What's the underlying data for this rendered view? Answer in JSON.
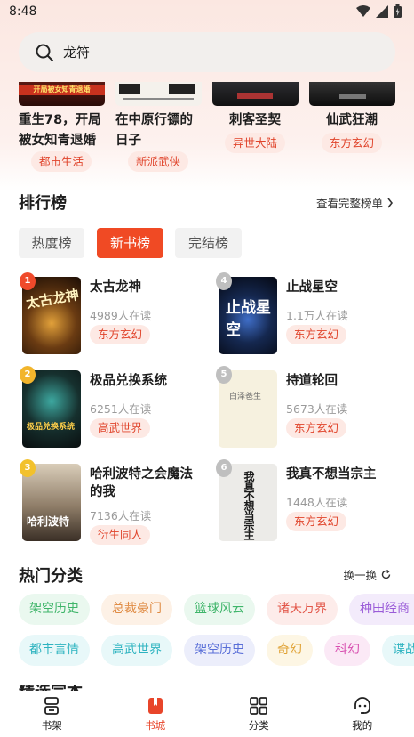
{
  "status": {
    "time": "8:48"
  },
  "search": {
    "query": "龙符"
  },
  "top_books": [
    {
      "title_line1": "重生78，开局",
      "title_line2": "被女知青退婚",
      "tag": "都市生活",
      "cover_text": "开局被女知青退婚"
    },
    {
      "title_line1": "在中原行镖的",
      "title_line2": "日子",
      "tag": "新派武侠",
      "cover_text": ""
    },
    {
      "title_line1": "刺客圣契",
      "title_line2": "",
      "tag": "异世大陆",
      "cover_text": ""
    },
    {
      "title_line1": "仙武狂潮",
      "title_line2": "",
      "tag": "东方玄幻",
      "cover_text": ""
    }
  ],
  "ranking": {
    "title": "排行榜",
    "see_all": "查看完整榜单",
    "tabs": [
      {
        "label": "热度榜",
        "active": false
      },
      {
        "label": "新书榜",
        "active": true
      },
      {
        "label": "完结榜",
        "active": false
      }
    ],
    "items": [
      {
        "rank": "1",
        "name": "太古龙神",
        "readers": "4989人在读",
        "tag": "东方玄幻",
        "cover_text": "太古龙神"
      },
      {
        "rank": "4",
        "name": "止战星空",
        "readers": "1.1万人在读",
        "tag": "东方玄幻",
        "cover_text": "止战星空"
      },
      {
        "rank": "2",
        "name": "极品兑换系统",
        "readers": "6251人在读",
        "tag": "高武世界",
        "cover_text": "极品兑换系统"
      },
      {
        "rank": "5",
        "name": "持道轮回",
        "readers": "5673人在读",
        "tag": "东方玄幻",
        "cover_text": "白泽爸生"
      },
      {
        "rank": "3",
        "name_line1": "哈利波特之会魔法",
        "name_line2": "的我",
        "readers": "7136人在读",
        "tag": "衍生同人",
        "cover_text": "哈利波特"
      },
      {
        "rank": "6",
        "name": "我真不想当宗主",
        "readers": "1448人在读",
        "tag": "东方玄幻",
        "cover_text": "我真不想当宗主"
      }
    ]
  },
  "categories": {
    "title": "热门分类",
    "refresh": "换一换",
    "row1": [
      "架空历史",
      "总裁豪门",
      "篮球风云",
      "诸天万界",
      "种田经商"
    ],
    "row2": [
      "都市言情",
      "高武世界",
      "架空历史",
      "奇幻",
      "科幻",
      "谍战"
    ]
  },
  "next_section_peek": "精选完本",
  "nav": [
    {
      "label": "书架",
      "icon": "bookshelf-icon",
      "active": false
    },
    {
      "label": "书城",
      "icon": "bookstore-icon",
      "active": true
    },
    {
      "label": "分类",
      "icon": "category-grid-icon",
      "active": false
    },
    {
      "label": "我的",
      "icon": "profile-icon",
      "active": false
    }
  ],
  "colors": {
    "accent": "#f04a24",
    "tag_text": "#e0442b",
    "tag_bg": "#fde9e4"
  }
}
